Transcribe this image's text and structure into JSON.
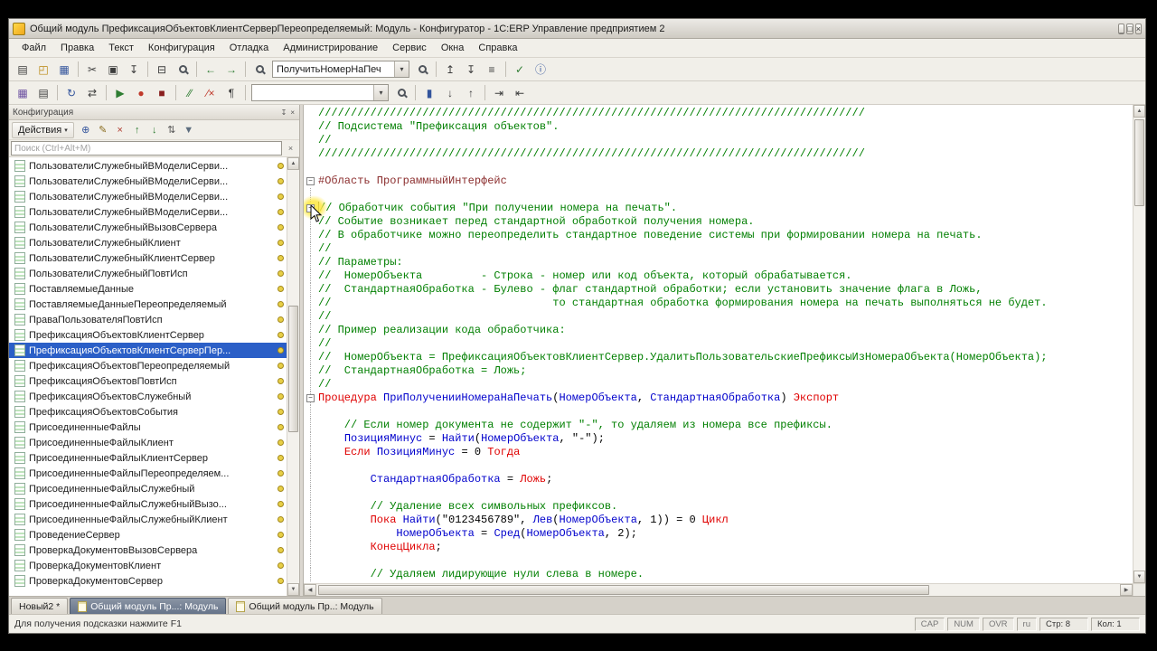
{
  "window": {
    "title": "Общий модуль ПрефиксацияОбъектовКлиентСерверПереопределяемый: Модуль - Конфигуратор - 1С:ERP Управление предприятием 2",
    "buttons": [
      {
        "name": "minimize",
        "glyph": "_"
      },
      {
        "name": "maximize",
        "glyph": "□"
      },
      {
        "name": "close",
        "glyph": "×"
      }
    ]
  },
  "menu": {
    "items": [
      {
        "label": "Файл",
        "name": "menu-file"
      },
      {
        "label": "Правка",
        "name": "menu-edit"
      },
      {
        "label": "Текст",
        "name": "menu-text"
      },
      {
        "label": "Конфигурация",
        "name": "menu-configuration"
      },
      {
        "label": "Отладка",
        "name": "menu-debug"
      },
      {
        "label": "Администрирование",
        "name": "menu-administration"
      },
      {
        "label": "Сервис",
        "name": "menu-service"
      },
      {
        "label": "Окна",
        "name": "menu-windows"
      },
      {
        "label": "Справка",
        "name": "menu-help"
      }
    ]
  },
  "toolbar_main": {
    "items": [
      {
        "type": "icon",
        "name": "new-file",
        "glyph": "▤"
      },
      {
        "type": "icon",
        "name": "open-file",
        "glyph": "◰",
        "color": "#b8860b"
      },
      {
        "type": "icon",
        "name": "save-file",
        "glyph": "▦",
        "color": "#33549c"
      },
      {
        "type": "sep"
      },
      {
        "type": "icon",
        "name": "cut",
        "glyph": "✂"
      },
      {
        "type": "icon",
        "name": "copy",
        "glyph": "▣"
      },
      {
        "type": "icon",
        "name": "paste",
        "glyph": "↧"
      },
      {
        "type": "sep"
      },
      {
        "type": "icon",
        "name": "print",
        "glyph": "⊟"
      },
      {
        "type": "icon",
        "name": "print-preview",
        "magnifier": true
      },
      {
        "type": "sep"
      },
      {
        "type": "icon",
        "name": "navigate-back",
        "glyph": "←",
        "color": "#2e7d32"
      },
      {
        "type": "icon",
        "name": "navigate-forward",
        "glyph": "→",
        "color": "#2e7d32"
      },
      {
        "type": "sep"
      },
      {
        "type": "icon",
        "name": "find",
        "magnifier": true
      },
      {
        "type": "combo",
        "name": "procedure-search-combo",
        "value": "ПолучитьНомерНаПеч"
      },
      {
        "type": "icon",
        "name": "find-next",
        "magnifier": true
      },
      {
        "type": "sep"
      },
      {
        "type": "icon",
        "name": "previous-procedure",
        "glyph": "↥"
      },
      {
        "type": "icon",
        "name": "next-procedure",
        "glyph": "↧"
      },
      {
        "type": "icon",
        "name": "procedures-list",
        "glyph": "≡"
      },
      {
        "type": "sep"
      },
      {
        "type": "icon",
        "name": "syntax-check",
        "glyph": "✓",
        "color": "#2e7d32"
      },
      {
        "type": "icon",
        "name": "help-info",
        "glyph": "ⓘ",
        "color": "#33549c"
      }
    ]
  },
  "toolbar_second": {
    "items": [
      {
        "type": "icon",
        "name": "open-configuration",
        "glyph": "▦",
        "color": "#6b4fa0"
      },
      {
        "type": "icon",
        "name": "configuration-objects",
        "glyph": "▤"
      },
      {
        "type": "sep"
      },
      {
        "type": "icon",
        "name": "update-db-configuration",
        "glyph": "↻",
        "color": "#33549c"
      },
      {
        "type": "icon",
        "name": "compare-configurations",
        "glyph": "⇄"
      },
      {
        "type": "sep"
      },
      {
        "type": "icon",
        "name": "start-debugging",
        "glyph": "▶",
        "color": "#2e7d32"
      },
      {
        "type": "icon",
        "name": "breakpoint",
        "glyph": "●",
        "color": "#c0392b"
      },
      {
        "type": "icon",
        "name": "stop-debugging",
        "glyph": "■",
        "color": "#8a1f1f"
      },
      {
        "type": "sep"
      },
      {
        "type": "icon",
        "name": "comment-block",
        "glyph": "∕∕",
        "color": "#2e7d32"
      },
      {
        "type": "icon",
        "name": "uncomment-block",
        "glyph": "∕×",
        "color": "#c0392b"
      },
      {
        "type": "icon",
        "name": "format-block",
        "glyph": "¶"
      },
      {
        "type": "sep"
      },
      {
        "type": "combo",
        "name": "goto-procedure-combo",
        "value": ""
      },
      {
        "type": "icon",
        "name": "find-procedure",
        "magnifier": true
      },
      {
        "type": "sep"
      },
      {
        "type": "icon",
        "name": "toggle-bookmark",
        "glyph": "▮",
        "color": "#33549c"
      },
      {
        "type": "icon",
        "name": "next-bookmark",
        "glyph": "↓"
      },
      {
        "type": "icon",
        "name": "previous-bookmark",
        "glyph": "↑"
      },
      {
        "type": "sep"
      },
      {
        "type": "icon",
        "name": "indent-increase",
        "glyph": "⇥"
      },
      {
        "type": "icon",
        "name": "indent-decrease",
        "glyph": "⇤"
      }
    ]
  },
  "sidebar": {
    "header": {
      "title": "Конфигурация",
      "buttons": [
        {
          "name": "pin-panel",
          "glyph": "↧"
        },
        {
          "name": "close-panel",
          "glyph": "×"
        }
      ]
    },
    "actions": {
      "button_label": "Действия",
      "icons": [
        {
          "name": "action-add",
          "glyph": "⊕",
          "color": "#33549c"
        },
        {
          "name": "action-edit",
          "glyph": "✎",
          "color": "#8a6d1f"
        },
        {
          "name": "action-delete",
          "glyph": "×",
          "color": "#b03a2e"
        },
        {
          "name": "action-move-up",
          "glyph": "↑",
          "color": "#2e7d32"
        },
        {
          "name": "action-move-down",
          "glyph": "↓",
          "color": "#2e7d32"
        },
        {
          "name": "action-sort",
          "glyph": "⇅",
          "color": "#555555"
        },
        {
          "name": "action-filter",
          "glyph": "▼",
          "color": "#5d6d7e"
        }
      ]
    },
    "search": {
      "placeholder": "Поиск (Ctrl+Alt+M)"
    },
    "items": [
      {
        "label": "ПользователиСлужебныйВМоделиСерви..."
      },
      {
        "label": "ПользователиСлужебныйВМоделиСерви..."
      },
      {
        "label": "ПользователиСлужебныйВМоделиСерви..."
      },
      {
        "label": "ПользователиСлужебныйВМоделиСерви..."
      },
      {
        "label": "ПользователиСлужебныйВызовСервера"
      },
      {
        "label": "ПользователиСлужебныйКлиент"
      },
      {
        "label": "ПользователиСлужебныйКлиентСервер"
      },
      {
        "label": "ПользователиСлужебныйПовтИсп"
      },
      {
        "label": "ПоставляемыеДанные"
      },
      {
        "label": "ПоставляемыеДанныеПереопределяемый"
      },
      {
        "label": "ПраваПользователяПовтИсп"
      },
      {
        "label": "ПрефиксацияОбъектовКлиентСервер"
      },
      {
        "label": "ПрефиксацияОбъектовКлиентСерверПер...",
        "selected": true
      },
      {
        "label": "ПрефиксацияОбъектовПереопределяемый"
      },
      {
        "label": "ПрефиксацияОбъектовПовтИсп"
      },
      {
        "label": "ПрефиксацияОбъектовСлужебный"
      },
      {
        "label": "ПрефиксацияОбъектовСобытия"
      },
      {
        "label": "ПрисоединенныеФайлы"
      },
      {
        "label": "ПрисоединенныеФайлыКлиент"
      },
      {
        "label": "ПрисоединенныеФайлыКлиентСервер"
      },
      {
        "label": "ПрисоединенныеФайлыПереопределяем..."
      },
      {
        "label": "ПрисоединенныеФайлыСлужебный"
      },
      {
        "label": "ПрисоединенныеФайлыСлужебныйВызо..."
      },
      {
        "label": "ПрисоединенныеФайлыСлужебныйКлиент"
      },
      {
        "label": "ПроведениеСервер"
      },
      {
        "label": "ПроверкаДокументовВызовСервера"
      },
      {
        "label": "ПроверкаДокументовКлиент"
      },
      {
        "label": "ПроверкаДокументовСервер"
      }
    ]
  },
  "editor": {
    "lines": [
      {
        "tokens": [
          [
            "////////////////////////////////////////////////////////////////////////////////////",
            "c"
          ]
        ]
      },
      {
        "tokens": [
          [
            "// Подсистема \"Префиксация объектов\".",
            "c"
          ]
        ]
      },
      {
        "tokens": [
          [
            "//",
            "c"
          ]
        ]
      },
      {
        "tokens": [
          [
            "////////////////////////////////////////////////////////////////////////////////////",
            "c"
          ]
        ]
      },
      {
        "tokens": []
      },
      {
        "fold": true,
        "tokens": [
          [
            "#Область ПрограммныйИнтерфейс",
            "d"
          ]
        ]
      },
      {
        "g": true,
        "tokens": []
      },
      {
        "g": true,
        "fold": true,
        "cursor": true,
        "tokens": [
          [
            "// Обработчик события \"При получении номера на печать\".",
            "c"
          ]
        ]
      },
      {
        "g": true,
        "tokens": [
          [
            "// Событие возникает перед стандартной обработкой получения номера.",
            "c"
          ]
        ]
      },
      {
        "g": true,
        "tokens": [
          [
            "// В обработчике можно переопределить стандартное поведение системы при формировании номера на печать.",
            "c"
          ]
        ]
      },
      {
        "g": true,
        "tokens": [
          [
            "//",
            "c"
          ]
        ]
      },
      {
        "g": true,
        "tokens": [
          [
            "// Параметры:",
            "c"
          ]
        ]
      },
      {
        "g": true,
        "tokens": [
          [
            "//  НомерОбъекта         - Строка - номер или код объекта, который обрабатывается.",
            "c"
          ]
        ]
      },
      {
        "g": true,
        "tokens": [
          [
            "//  СтандартнаяОбработка - Булево - флаг стандартной обработки; если установить значение флага в Ложь,",
            "c"
          ]
        ]
      },
      {
        "g": true,
        "tokens": [
          [
            "//                                  то стандартная обработка формирования номера на печать выполняться не будет.",
            "c"
          ]
        ]
      },
      {
        "g": true,
        "tokens": [
          [
            "//",
            "c"
          ]
        ]
      },
      {
        "g": true,
        "tokens": [
          [
            "// Пример реализации кода обработчика:",
            "c"
          ]
        ]
      },
      {
        "g": true,
        "tokens": [
          [
            "//",
            "c"
          ]
        ]
      },
      {
        "g": true,
        "tokens": [
          [
            "//  НомерОбъекта = ПрефиксацияОбъектовКлиентСервер.УдалитьПользовательскиеПрефиксыИзНомераОбъекта(НомерОбъекта);",
            "c"
          ]
        ]
      },
      {
        "g": true,
        "tokens": [
          [
            "//  СтандартнаяОбработка = Ложь;",
            "c"
          ]
        ]
      },
      {
        "g": true,
        "tokens": [
          [
            "//",
            "c"
          ]
        ]
      },
      {
        "g": true,
        "fold": true,
        "tokens": [
          [
            "Процедура ",
            "k"
          ],
          [
            "ПриПолученииНомераНаПечать",
            "i"
          ],
          [
            "(",
            "p"
          ],
          [
            "НомерОбъекта",
            "i"
          ],
          [
            ", ",
            "p"
          ],
          [
            "СтандартнаяОбработка",
            "i"
          ],
          [
            ") ",
            "p"
          ],
          [
            "Экспорт",
            "k"
          ]
        ]
      },
      {
        "g": true,
        "tokens": []
      },
      {
        "g": true,
        "tokens": [
          [
            "    // Если номер документа не содержит \"-\", то удаляем из номера все префиксы.",
            "c"
          ]
        ]
      },
      {
        "g": true,
        "tokens": [
          [
            "    ",
            "p"
          ],
          [
            "ПозицияМинус",
            "i"
          ],
          [
            " = ",
            "p"
          ],
          [
            "Найти",
            "i"
          ],
          [
            "(",
            "p"
          ],
          [
            "НомерОбъекта",
            "i"
          ],
          [
            ", \"-\");",
            "p"
          ]
        ]
      },
      {
        "g": true,
        "tokens": [
          [
            "    ",
            "p"
          ],
          [
            "Если ",
            "k"
          ],
          [
            "ПозицияМинус",
            "i"
          ],
          [
            " = 0 ",
            "p"
          ],
          [
            "Тогда",
            "k"
          ]
        ]
      },
      {
        "g": true,
        "tokens": []
      },
      {
        "g": true,
        "tokens": [
          [
            "        ",
            "p"
          ],
          [
            "СтандартнаяОбработка",
            "i"
          ],
          [
            " = ",
            "p"
          ],
          [
            "Ложь",
            "k"
          ],
          [
            ";",
            "p"
          ]
        ]
      },
      {
        "g": true,
        "tokens": []
      },
      {
        "g": true,
        "tokens": [
          [
            "        // Удаление всех символьных префиксов.",
            "c"
          ]
        ]
      },
      {
        "g": true,
        "tokens": [
          [
            "        ",
            "p"
          ],
          [
            "Пока ",
            "k"
          ],
          [
            "Найти",
            "i"
          ],
          [
            "(\"0123456789\", ",
            "p"
          ],
          [
            "Лев",
            "i"
          ],
          [
            "(",
            "p"
          ],
          [
            "НомерОбъекта",
            "i"
          ],
          [
            ", 1)) = 0 ",
            "p"
          ],
          [
            "Цикл",
            "k"
          ]
        ]
      },
      {
        "g": true,
        "tokens": [
          [
            "            ",
            "p"
          ],
          [
            "НомерОбъекта",
            "i"
          ],
          [
            " = ",
            "p"
          ],
          [
            "Сред",
            "i"
          ],
          [
            "(",
            "p"
          ],
          [
            "НомерОбъекта",
            "i"
          ],
          [
            ", 2);",
            "p"
          ]
        ]
      },
      {
        "g": true,
        "tokens": [
          [
            "        ",
            "p"
          ],
          [
            "КонецЦикла",
            "k"
          ],
          [
            ";",
            "p"
          ]
        ]
      },
      {
        "g": true,
        "tokens": []
      },
      {
        "g": true,
        "tokens": [
          [
            "        // Удаляем лидирующие нули слева в номере.",
            "c"
          ]
        ]
      }
    ]
  },
  "tabs": {
    "items": [
      {
        "label": "Новый2 *",
        "icon": false,
        "active": false
      },
      {
        "label": "Общий модуль Пр...: Модуль",
        "icon": true,
        "active": true
      },
      {
        "label": "Общий модуль Пр..: Модуль",
        "icon": true,
        "active": false
      }
    ]
  },
  "statusbar": {
    "message": "Для получения подсказки нажмите F1",
    "indicators": [
      {
        "name": "caps-indicator",
        "label": "CAP"
      },
      {
        "name": "num-indicator",
        "label": "NUM"
      },
      {
        "name": "ovr-indicator",
        "label": "OVR"
      },
      {
        "name": "lang-indicator",
        "label": "ru"
      }
    ],
    "line": "Стр: 8",
    "column": "Кол: 1"
  },
  "glyphs": {
    "chevron_down": "▾",
    "fold_collapse": "−",
    "scroll_up": "▲",
    "scroll_down": "▼",
    "scroll_left": "◀",
    "scroll_right": "▶",
    "search_clear": "×"
  },
  "colors": {
    "selection": "#2b5fc7",
    "comment": "#007f00",
    "keyword": "#df0000",
    "identifier": "#0000cc",
    "directive": "#8b2e2e",
    "module_dot": "#e8cf46",
    "titlebar_from": "#eceae6",
    "titlebar_to": "#cfcbc3"
  }
}
